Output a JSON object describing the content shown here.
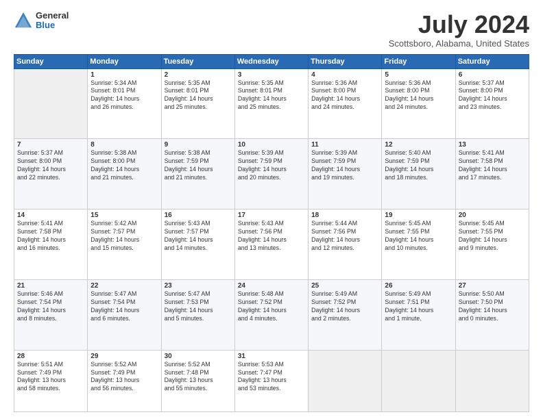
{
  "logo": {
    "general": "General",
    "blue": "Blue"
  },
  "title": "July 2024",
  "location": "Scottsboro, Alabama, United States",
  "days": [
    "Sunday",
    "Monday",
    "Tuesday",
    "Wednesday",
    "Thursday",
    "Friday",
    "Saturday"
  ],
  "weeks": [
    [
      {
        "day": "",
        "info": ""
      },
      {
        "day": "1",
        "info": "Sunrise: 5:34 AM\nSunset: 8:01 PM\nDaylight: 14 hours\nand 26 minutes."
      },
      {
        "day": "2",
        "info": "Sunrise: 5:35 AM\nSunset: 8:01 PM\nDaylight: 14 hours\nand 25 minutes."
      },
      {
        "day": "3",
        "info": "Sunrise: 5:35 AM\nSunset: 8:01 PM\nDaylight: 14 hours\nand 25 minutes."
      },
      {
        "day": "4",
        "info": "Sunrise: 5:36 AM\nSunset: 8:00 PM\nDaylight: 14 hours\nand 24 minutes."
      },
      {
        "day": "5",
        "info": "Sunrise: 5:36 AM\nSunset: 8:00 PM\nDaylight: 14 hours\nand 24 minutes."
      },
      {
        "day": "6",
        "info": "Sunrise: 5:37 AM\nSunset: 8:00 PM\nDaylight: 14 hours\nand 23 minutes."
      }
    ],
    [
      {
        "day": "7",
        "info": "Sunrise: 5:37 AM\nSunset: 8:00 PM\nDaylight: 14 hours\nand 22 minutes."
      },
      {
        "day": "8",
        "info": "Sunrise: 5:38 AM\nSunset: 8:00 PM\nDaylight: 14 hours\nand 21 minutes."
      },
      {
        "day": "9",
        "info": "Sunrise: 5:38 AM\nSunset: 7:59 PM\nDaylight: 14 hours\nand 21 minutes."
      },
      {
        "day": "10",
        "info": "Sunrise: 5:39 AM\nSunset: 7:59 PM\nDaylight: 14 hours\nand 20 minutes."
      },
      {
        "day": "11",
        "info": "Sunrise: 5:39 AM\nSunset: 7:59 PM\nDaylight: 14 hours\nand 19 minutes."
      },
      {
        "day": "12",
        "info": "Sunrise: 5:40 AM\nSunset: 7:59 PM\nDaylight: 14 hours\nand 18 minutes."
      },
      {
        "day": "13",
        "info": "Sunrise: 5:41 AM\nSunset: 7:58 PM\nDaylight: 14 hours\nand 17 minutes."
      }
    ],
    [
      {
        "day": "14",
        "info": "Sunrise: 5:41 AM\nSunset: 7:58 PM\nDaylight: 14 hours\nand 16 minutes."
      },
      {
        "day": "15",
        "info": "Sunrise: 5:42 AM\nSunset: 7:57 PM\nDaylight: 14 hours\nand 15 minutes."
      },
      {
        "day": "16",
        "info": "Sunrise: 5:43 AM\nSunset: 7:57 PM\nDaylight: 14 hours\nand 14 minutes."
      },
      {
        "day": "17",
        "info": "Sunrise: 5:43 AM\nSunset: 7:56 PM\nDaylight: 14 hours\nand 13 minutes."
      },
      {
        "day": "18",
        "info": "Sunrise: 5:44 AM\nSunset: 7:56 PM\nDaylight: 14 hours\nand 12 minutes."
      },
      {
        "day": "19",
        "info": "Sunrise: 5:45 AM\nSunset: 7:55 PM\nDaylight: 14 hours\nand 10 minutes."
      },
      {
        "day": "20",
        "info": "Sunrise: 5:45 AM\nSunset: 7:55 PM\nDaylight: 14 hours\nand 9 minutes."
      }
    ],
    [
      {
        "day": "21",
        "info": "Sunrise: 5:46 AM\nSunset: 7:54 PM\nDaylight: 14 hours\nand 8 minutes."
      },
      {
        "day": "22",
        "info": "Sunrise: 5:47 AM\nSunset: 7:54 PM\nDaylight: 14 hours\nand 6 minutes."
      },
      {
        "day": "23",
        "info": "Sunrise: 5:47 AM\nSunset: 7:53 PM\nDaylight: 14 hours\nand 5 minutes."
      },
      {
        "day": "24",
        "info": "Sunrise: 5:48 AM\nSunset: 7:52 PM\nDaylight: 14 hours\nand 4 minutes."
      },
      {
        "day": "25",
        "info": "Sunrise: 5:49 AM\nSunset: 7:52 PM\nDaylight: 14 hours\nand 2 minutes."
      },
      {
        "day": "26",
        "info": "Sunrise: 5:49 AM\nSunset: 7:51 PM\nDaylight: 14 hours\nand 1 minute."
      },
      {
        "day": "27",
        "info": "Sunrise: 5:50 AM\nSunset: 7:50 PM\nDaylight: 14 hours\nand 0 minutes."
      }
    ],
    [
      {
        "day": "28",
        "info": "Sunrise: 5:51 AM\nSunset: 7:49 PM\nDaylight: 13 hours\nand 58 minutes."
      },
      {
        "day": "29",
        "info": "Sunrise: 5:52 AM\nSunset: 7:49 PM\nDaylight: 13 hours\nand 56 minutes."
      },
      {
        "day": "30",
        "info": "Sunrise: 5:52 AM\nSunset: 7:48 PM\nDaylight: 13 hours\nand 55 minutes."
      },
      {
        "day": "31",
        "info": "Sunrise: 5:53 AM\nSunset: 7:47 PM\nDaylight: 13 hours\nand 53 minutes."
      },
      {
        "day": "",
        "info": ""
      },
      {
        "day": "",
        "info": ""
      },
      {
        "day": "",
        "info": ""
      }
    ]
  ]
}
